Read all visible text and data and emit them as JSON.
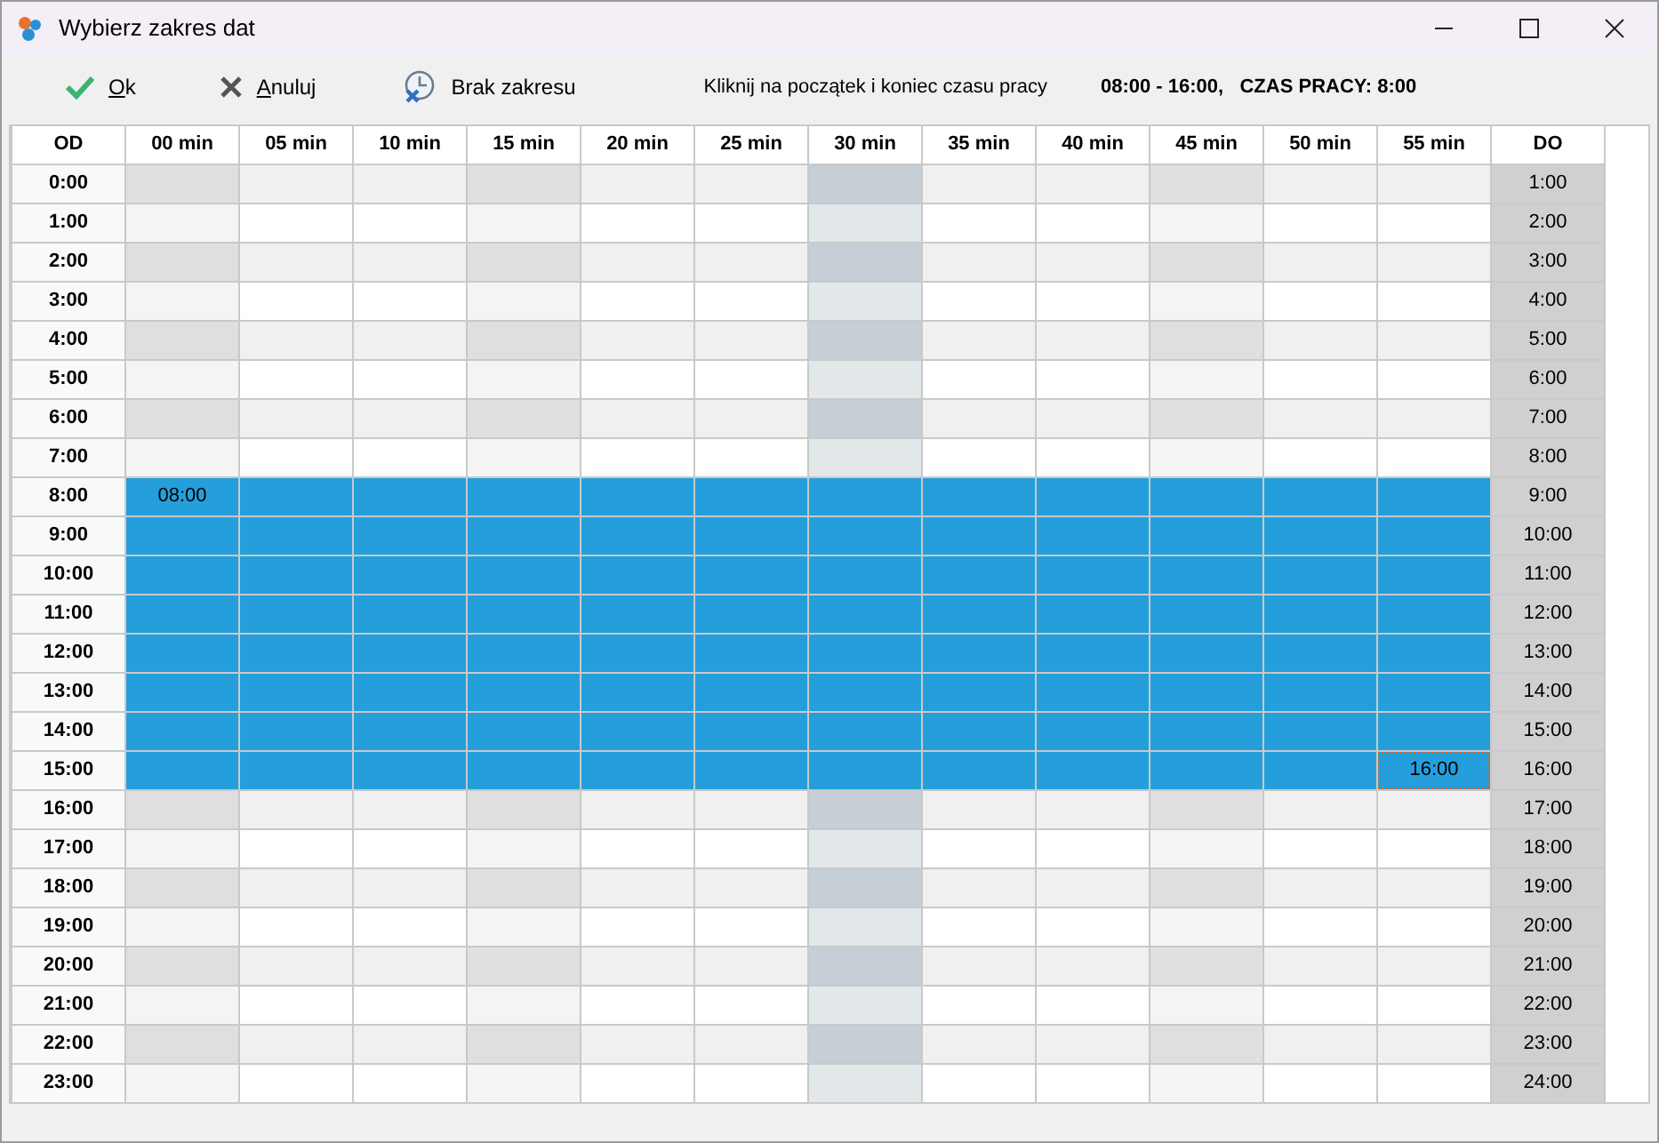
{
  "window": {
    "title": "Wybierz zakres dat"
  },
  "toolbar": [
    {
      "kind": "ok",
      "label": "Ok",
      "accesskey": true
    },
    {
      "kind": "cancel",
      "label": "Anuluj",
      "accesskey": true
    },
    {
      "kind": "clear",
      "label": "Brak zakresu",
      "accesskey": false
    }
  ],
  "hint": "Kliknij na początek i koniec czasu pracy",
  "summary": "08:00 - 16:00,   CZAS PRACY: 8:00",
  "grid": {
    "from_header": "OD",
    "to_header": "DO",
    "columns": [
      {
        "label": "00 min",
        "kind": "quarter"
      },
      {
        "label": "05 min",
        "kind": "plain"
      },
      {
        "label": "10 min",
        "kind": "plain"
      },
      {
        "label": "15 min",
        "kind": "quarter"
      },
      {
        "label": "20 min",
        "kind": "plain"
      },
      {
        "label": "25 min",
        "kind": "plain"
      },
      {
        "label": "30 min",
        "kind": "half"
      },
      {
        "label": "35 min",
        "kind": "plain"
      },
      {
        "label": "40 min",
        "kind": "plain"
      },
      {
        "label": "45 min",
        "kind": "quarter"
      },
      {
        "label": "50 min",
        "kind": "plain"
      },
      {
        "label": "55 min",
        "kind": "plain"
      }
    ],
    "rows": [
      {
        "from": "0:00",
        "to": "1:00",
        "striped": true,
        "selected": false
      },
      {
        "from": "1:00",
        "to": "2:00",
        "striped": false,
        "selected": false
      },
      {
        "from": "2:00",
        "to": "3:00",
        "striped": true,
        "selected": false
      },
      {
        "from": "3:00",
        "to": "4:00",
        "striped": false,
        "selected": false
      },
      {
        "from": "4:00",
        "to": "5:00",
        "striped": true,
        "selected": false
      },
      {
        "from": "5:00",
        "to": "6:00",
        "striped": false,
        "selected": false
      },
      {
        "from": "6:00",
        "to": "7:00",
        "striped": true,
        "selected": false
      },
      {
        "from": "7:00",
        "to": "8:00",
        "striped": false,
        "selected": false
      },
      {
        "from": "8:00",
        "to": "9:00",
        "selected": true,
        "tag": {
          "text": "08:00",
          "kind": "start",
          "focused": false
        }
      },
      {
        "from": "9:00",
        "to": "10:00",
        "selected": true
      },
      {
        "from": "10:00",
        "to": "11:00",
        "selected": true
      },
      {
        "from": "11:00",
        "to": "12:00",
        "selected": true
      },
      {
        "from": "12:00",
        "to": "13:00",
        "selected": true
      },
      {
        "from": "13:00",
        "to": "14:00",
        "selected": true
      },
      {
        "from": "14:00",
        "to": "15:00",
        "selected": true
      },
      {
        "from": "15:00",
        "to": "16:00",
        "selected": true,
        "tag": {
          "text": "16:00",
          "kind": "end",
          "focused": true
        }
      },
      {
        "from": "16:00",
        "to": "17:00",
        "striped": true,
        "selected": false
      },
      {
        "from": "17:00",
        "to": "18:00",
        "striped": false,
        "selected": false
      },
      {
        "from": "18:00",
        "to": "19:00",
        "striped": true,
        "selected": false
      },
      {
        "from": "19:00",
        "to": "20:00",
        "striped": false,
        "selected": false
      },
      {
        "from": "20:00",
        "to": "21:00",
        "striped": true,
        "selected": false
      },
      {
        "from": "21:00",
        "to": "22:00",
        "striped": false,
        "selected": false
      },
      {
        "from": "22:00",
        "to": "23:00",
        "striped": true,
        "selected": false
      },
      {
        "from": "23:00",
        "to": "24:00",
        "striped": false,
        "selected": false
      }
    ]
  }
}
